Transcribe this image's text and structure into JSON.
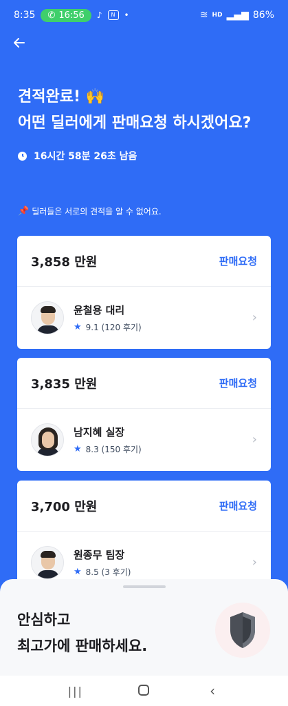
{
  "status_bar": {
    "time": "8:35",
    "call_time": "16:56",
    "network_label": "HD",
    "battery": "86%"
  },
  "header": {
    "title_line1": "견적완료! 🙌",
    "title_line2": "어떤 딜러에게 판매요청 하시겠어요?",
    "timer": "16시간 58분 26초 남음"
  },
  "notice": {
    "icon": "pushpin-icon",
    "text": "딜러들은 서로의 견적을 알 수 없어요."
  },
  "offers": [
    {
      "price": "3,858 만원",
      "request_label": "판매요청",
      "dealer_name": "윤철용 대리",
      "rating": "9.1 (120 후기)"
    },
    {
      "price": "3,835 만원",
      "request_label": "판매요청",
      "dealer_name": "남지혜 실장",
      "rating": "8.3 (150 후기)"
    },
    {
      "price": "3,700 만원",
      "request_label": "판매요청",
      "dealer_name": "원종무 팀장",
      "rating": "8.5 (3 후기)"
    }
  ],
  "bottom_sheet": {
    "title_line1": "안심하고",
    "title_line2": "최고가에 판매하세요."
  },
  "colors": {
    "brand_blue": "#2f6cf6",
    "white": "#ffffff"
  }
}
